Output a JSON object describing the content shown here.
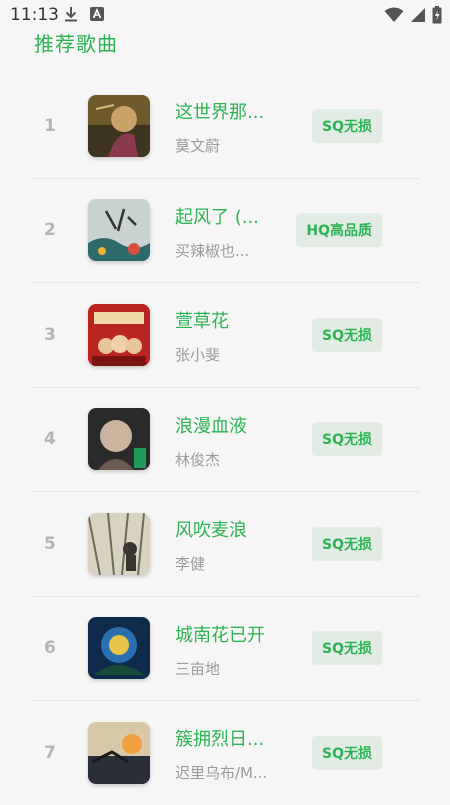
{
  "status_bar": {
    "time": "11:13",
    "icons": [
      "download-icon",
      "a-icon",
      "wifi-icon",
      "signal-icon",
      "battery-icon"
    ]
  },
  "section": {
    "title": "推荐歌曲"
  },
  "songs": [
    {
      "rank": "1",
      "title": "这世界那...",
      "artist": "莫文蔚",
      "quality": "SQ无损"
    },
    {
      "rank": "2",
      "title": "起风了 (...",
      "artist": "买辣椒也...",
      "quality": "HQ高品质"
    },
    {
      "rank": "3",
      "title": "萱草花",
      "artist": "张小斐",
      "quality": "SQ无损"
    },
    {
      "rank": "4",
      "title": "浪漫血液",
      "artist": "林俊杰",
      "quality": "SQ无损"
    },
    {
      "rank": "5",
      "title": "风吹麦浪",
      "artist": "李健",
      "quality": "SQ无损"
    },
    {
      "rank": "6",
      "title": "城南花已开",
      "artist": "三亩地",
      "quality": "SQ无损"
    },
    {
      "rank": "7",
      "title": "簇拥烈日...",
      "artist": "迟里乌布/M...",
      "quality": "SQ无损"
    }
  ],
  "colors": {
    "accent": "#2db354",
    "badge_bg": "#e3ece4",
    "rank_gray": "#b5b5b5",
    "artist_gray": "#9a9a9a",
    "background": "#f6f6f6"
  }
}
